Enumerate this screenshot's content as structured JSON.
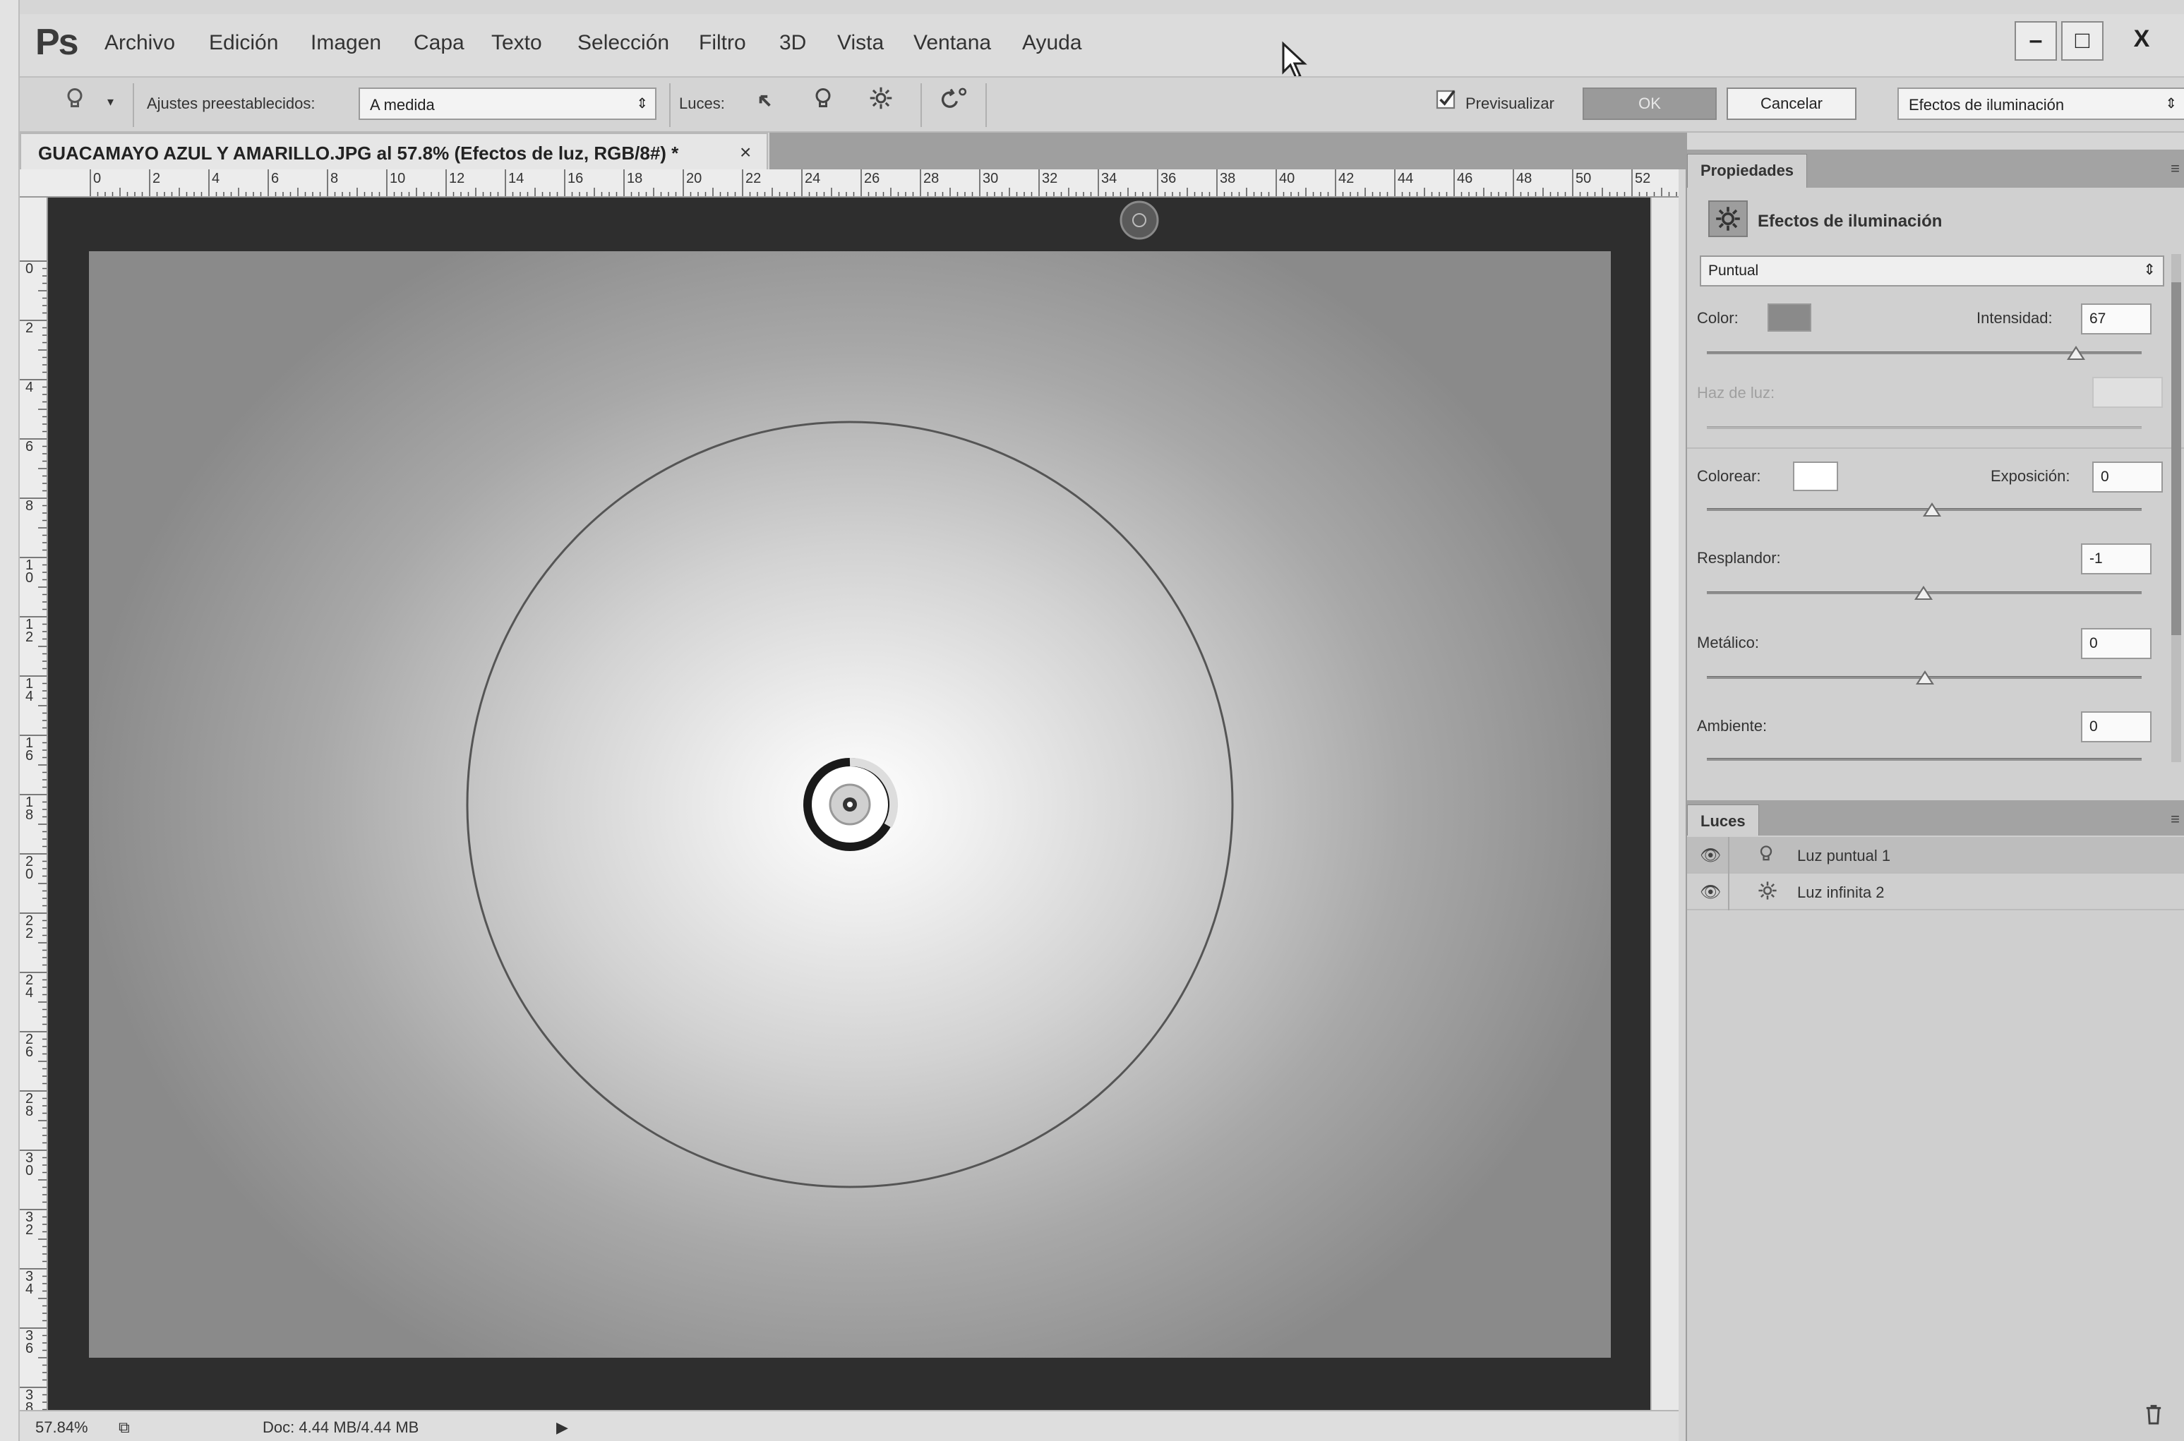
{
  "app": {
    "logo": "Ps",
    "menu": [
      "Archivo",
      "Edición",
      "Imagen",
      "Capa",
      "Texto",
      "Selección",
      "Filtro",
      "3D",
      "Vista",
      "Ventana",
      "Ayuda"
    ],
    "window_controls": {
      "minimize": "–",
      "maximize": "□",
      "close": "X"
    }
  },
  "options_bar": {
    "presets_label": "Ajustes preestablecidos:",
    "presets_value": "A medida",
    "lights_label": "Luces:",
    "preview_label": "Previsualizar",
    "preview_checked": true,
    "ok_label": "OK",
    "cancel_label": "Cancelar",
    "workspace_value": "Efectos de iluminación"
  },
  "document": {
    "tab_title": "GUACAMAYO AZUL Y AMARILLO.JPG al 57.8% (Efectos de luz, RGB/8#) *",
    "close": "×",
    "ruler_top": [
      "0",
      "2",
      "4",
      "6",
      "8",
      "10",
      "12",
      "14",
      "16",
      "18",
      "20",
      "22",
      "24",
      "26",
      "28",
      "30",
      "32",
      "34",
      "36",
      "38",
      "40",
      "42",
      "44",
      "46",
      "48",
      "50",
      "52"
    ],
    "ruler_left": [
      "0",
      "2",
      "4",
      "6",
      "8",
      "10",
      "12",
      "14",
      "16",
      "18",
      "20",
      "22",
      "24",
      "26",
      "28",
      "30",
      "32",
      "34",
      "36",
      "38"
    ]
  },
  "status": {
    "zoom": "57.84%",
    "doc_info": "Doc: 4.44 MB/4.44 MB"
  },
  "properties": {
    "tab": "Propiedades",
    "title": "Efectos de iluminación",
    "light_type": "Puntual",
    "color_label": "Color:",
    "intensity_label": "Intensidad:",
    "intensity_value": "67",
    "hotspot_label": "Haz de luz:",
    "colorize_label": "Colorear:",
    "exposure_label": "Exposición:",
    "exposure_value": "0",
    "gloss_label": "Resplandor:",
    "gloss_value": "-1",
    "metallic_label": "Metálico:",
    "metallic_value": "0",
    "ambience_label": "Ambiente:",
    "ambience_value": "0",
    "colors": {
      "light_color": "#8a8a8a",
      "colorize_color": "#ffffff"
    }
  },
  "lights_panel": {
    "tab": "Luces",
    "items": [
      {
        "name": "Luz puntual 1",
        "icon": "bulb-icon"
      },
      {
        "name": "Luz infinita 2",
        "icon": "sun-icon"
      }
    ]
  }
}
